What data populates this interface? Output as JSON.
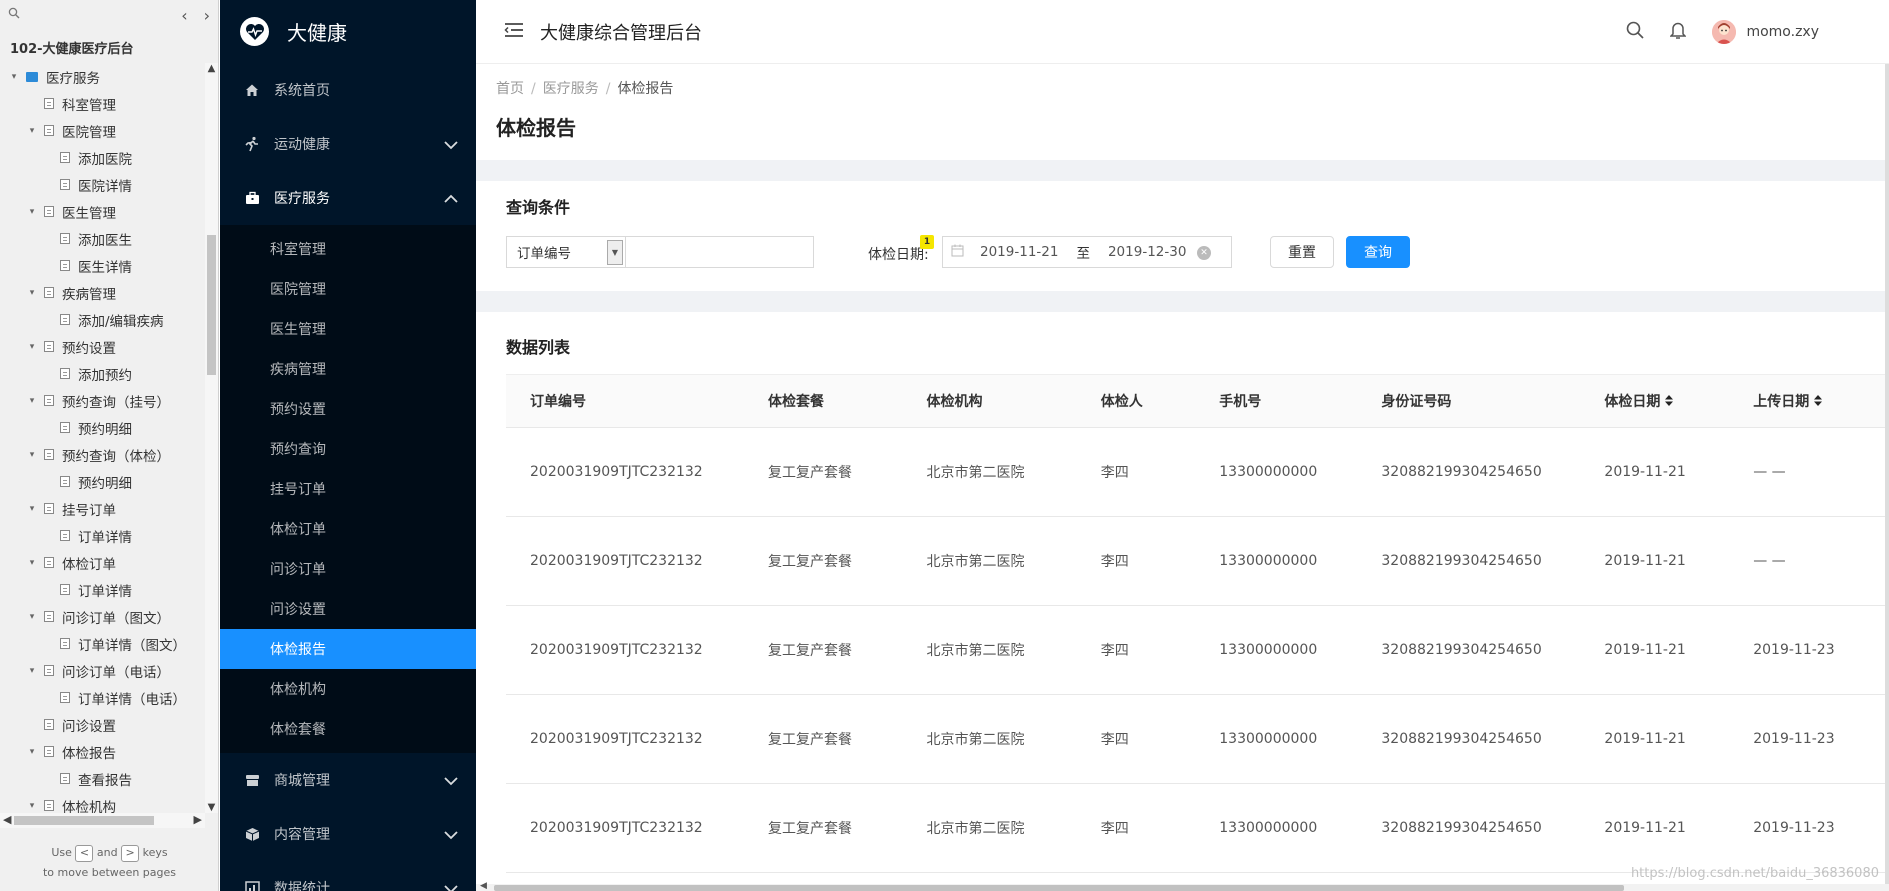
{
  "axure": {
    "project_title": "102-大健康医疗后台",
    "tree": [
      {
        "label": "医疗服务",
        "level": 0,
        "folder": true
      },
      {
        "label": "科室管理",
        "level": 1,
        "toggle": false
      },
      {
        "label": "医院管理",
        "level": 1,
        "toggle": true
      },
      {
        "label": "添加医院",
        "level": 2
      },
      {
        "label": "医院详情",
        "level": 2
      },
      {
        "label": "医生管理",
        "level": 1,
        "toggle": true
      },
      {
        "label": "添加医生",
        "level": 2
      },
      {
        "label": "医生详情",
        "level": 2
      },
      {
        "label": "疾病管理",
        "level": 1,
        "toggle": true
      },
      {
        "label": "添加/编辑疾病",
        "level": 2
      },
      {
        "label": "预约设置",
        "level": 1,
        "toggle": true
      },
      {
        "label": "添加预约",
        "level": 2
      },
      {
        "label": "预约查询（挂号）",
        "level": 1,
        "toggle": true
      },
      {
        "label": "预约明细",
        "level": 2
      },
      {
        "label": "预约查询（体检）",
        "level": 1,
        "toggle": true
      },
      {
        "label": "预约明细",
        "level": 2
      },
      {
        "label": "挂号订单",
        "level": 1,
        "toggle": true
      },
      {
        "label": "订单详情",
        "level": 2
      },
      {
        "label": "体检订单",
        "level": 1,
        "toggle": true
      },
      {
        "label": "订单详情",
        "level": 2
      },
      {
        "label": "问诊订单（图文）",
        "level": 1,
        "toggle": true
      },
      {
        "label": "订单详情（图文）",
        "level": 2
      },
      {
        "label": "问诊订单（电话）",
        "level": 1,
        "toggle": true
      },
      {
        "label": "订单详情（电话）",
        "level": 2
      },
      {
        "label": "问诊设置",
        "level": 1,
        "toggle": false
      },
      {
        "label": "体检报告",
        "level": 1,
        "toggle": true
      },
      {
        "label": "查看报告",
        "level": 2
      },
      {
        "label": "体检机构",
        "level": 1,
        "toggle": true
      }
    ],
    "hint_use": "Use",
    "hint_and": "and",
    "hint_keys": "keys",
    "hint_line2": "to move between pages",
    "key_left": "<",
    "key_right": ">"
  },
  "sidebar": {
    "brand": "大健康",
    "items_top": [
      {
        "label": "系统首页",
        "icon": "home-icon"
      },
      {
        "label": "运动健康",
        "icon": "run-icon",
        "chevron": "down"
      },
      {
        "label": "医疗服务",
        "icon": "briefcase-icon",
        "chevron": "up",
        "open": true
      }
    ],
    "sub_items": [
      {
        "label": "科室管理"
      },
      {
        "label": "医院管理"
      },
      {
        "label": "医生管理"
      },
      {
        "label": "疾病管理"
      },
      {
        "label": "预约设置"
      },
      {
        "label": "预约查询"
      },
      {
        "label": "挂号订单"
      },
      {
        "label": "体检订单"
      },
      {
        "label": "问诊订单"
      },
      {
        "label": "问诊设置"
      },
      {
        "label": "体检报告",
        "active": true
      },
      {
        "label": "体检机构"
      },
      {
        "label": "体检套餐"
      }
    ],
    "items_bottom": [
      {
        "label": "商城管理",
        "icon": "shop-icon"
      },
      {
        "label": "内容管理",
        "icon": "box-icon"
      },
      {
        "label": "数据统计",
        "icon": "chart-icon"
      }
    ]
  },
  "topbar": {
    "title": "大健康综合管理后台",
    "username": "momo.zxy"
  },
  "breadcrumb": {
    "home": "首页",
    "section": "医疗服务",
    "current": "体检报告",
    "separator": "/"
  },
  "page_title": "体检报告",
  "query": {
    "title": "查询条件",
    "select_value": "订单编号",
    "input_value": "",
    "date_label": "体检日期:",
    "badge": "1",
    "date_start": "2019-11-21",
    "date_to": "至",
    "date_end": "2019-12-30",
    "reset_label": "重置",
    "query_label": "查询"
  },
  "table": {
    "title": "数据列表",
    "columns": [
      "订单编号",
      "体检套餐",
      "体检机构",
      "体检人",
      "手机号",
      "身份证号码",
      "体检日期",
      "上传日期"
    ],
    "rows": [
      [
        "2020031909TJTC232132",
        "复工复产套餐",
        "北京市第二医院",
        "李四",
        "13300000000",
        "320882199304254650",
        "2019-11-21",
        "— —"
      ],
      [
        "2020031909TJTC232132",
        "复工复产套餐",
        "北京市第二医院",
        "李四",
        "13300000000",
        "320882199304254650",
        "2019-11-21",
        "— —"
      ],
      [
        "2020031909TJTC232132",
        "复工复产套餐",
        "北京市第二医院",
        "李四",
        "13300000000",
        "320882199304254650",
        "2019-11-21",
        "2019-11-23"
      ],
      [
        "2020031909TJTC232132",
        "复工复产套餐",
        "北京市第二医院",
        "李四",
        "13300000000",
        "320882199304254650",
        "2019-11-21",
        "2019-11-23"
      ],
      [
        "2020031909TJTC232132",
        "复工复产套餐",
        "北京市第二医院",
        "李四",
        "13300000000",
        "320882199304254650",
        "2019-11-21",
        "2019-11-23"
      ]
    ]
  },
  "watermark": "https://blog.csdn.net/baidu_36836080",
  "colors": {
    "sidebar_bg": "#001529",
    "submenu_bg": "#000c17",
    "accent": "#1890ff",
    "page_bg": "#f0f2f5"
  }
}
